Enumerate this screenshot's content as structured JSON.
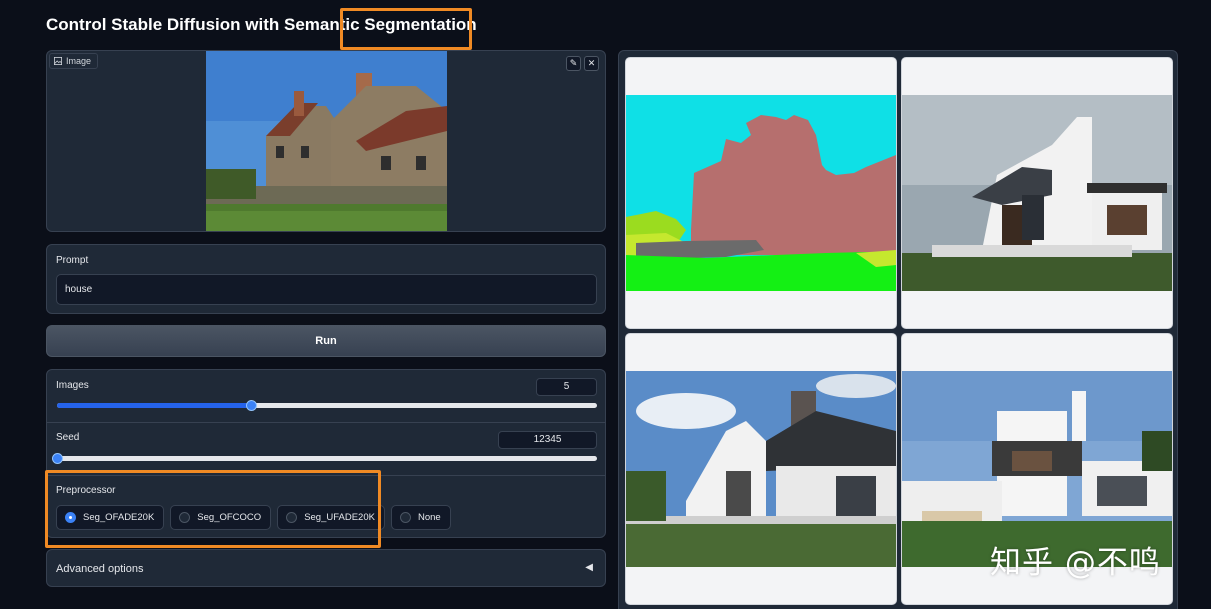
{
  "page": {
    "title": "Control Stable Diffusion with Semantic Segmentation"
  },
  "image_input": {
    "label": "Image",
    "edit_icon": "pencil-icon",
    "clear_icon": "close-icon"
  },
  "prompt": {
    "label": "Prompt",
    "value": "house"
  },
  "run_button": {
    "label": "Run"
  },
  "images_slider": {
    "label": "Images",
    "value": "5",
    "fraction": 0.36
  },
  "seed_slider": {
    "label": "Seed",
    "value": "12345",
    "fraction": 0.0
  },
  "preprocessor": {
    "label": "Preprocessor",
    "options": [
      {
        "label": "Seg_OFADE20K",
        "selected": true
      },
      {
        "label": "Seg_OFCOCO",
        "selected": false
      },
      {
        "label": "Seg_UFADE20K",
        "selected": false
      },
      {
        "label": "None",
        "selected": false
      }
    ]
  },
  "advanced": {
    "label": "Advanced options",
    "arrow_icon": "triangle-left-icon"
  },
  "watermark": "知乎 @不鸣",
  "colors": {
    "highlight": "#f08a24",
    "accent": "#3b82f6",
    "background": "#0b0f19"
  }
}
